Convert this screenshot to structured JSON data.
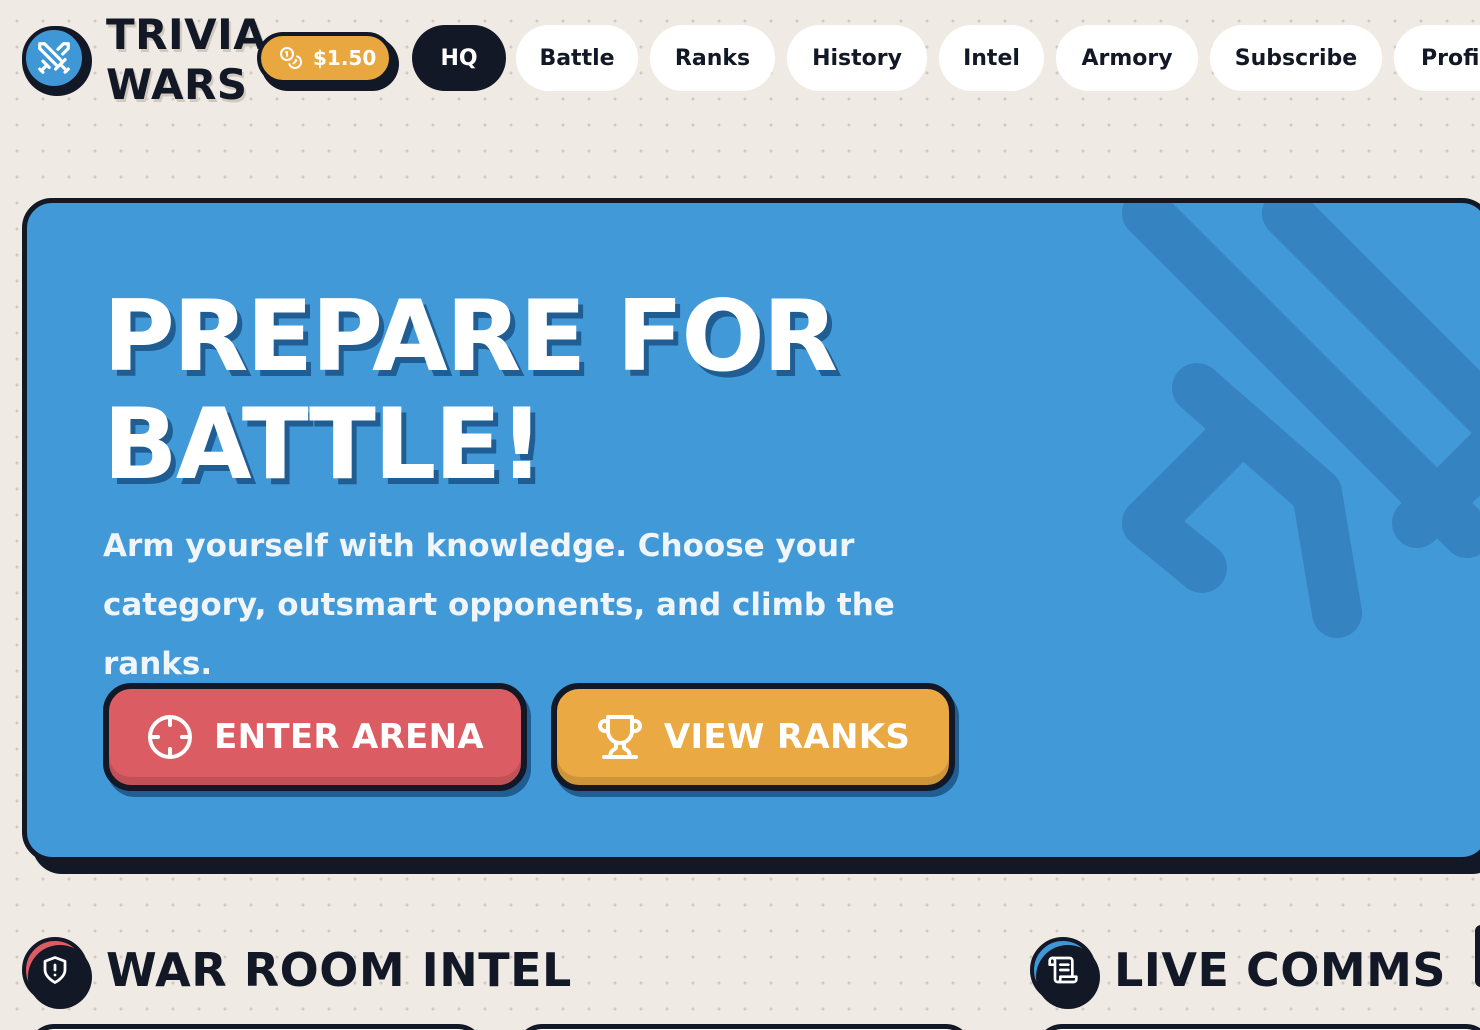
{
  "header": {
    "logo_line1": "TRIVIA",
    "logo_line2": "WARS",
    "logo_icon": "crossed-swords-icon",
    "coins_label": "$1.50",
    "coins_icon": "coins-icon",
    "nav": [
      {
        "label": "HQ",
        "active": true
      },
      {
        "label": "Battle"
      },
      {
        "label": "Ranks"
      },
      {
        "label": "History"
      },
      {
        "label": "Intel"
      },
      {
        "label": "Armory"
      },
      {
        "label": "Subscribe"
      },
      {
        "label": "Profil"
      }
    ]
  },
  "hero": {
    "title_line1": "PREPARE FOR",
    "title_line2": "BATTLE!",
    "subtitle": "Arm yourself with knowledge. Choose your category, outsmart opponents, and climb the ranks.",
    "primary_button": {
      "label": "ENTER ARENA",
      "icon": "crosshair-icon"
    },
    "secondary_button": {
      "label": "VIEW RANKS",
      "icon": "trophy-icon"
    }
  },
  "sections": {
    "war_room": {
      "title": "WAR ROOM INTEL",
      "icon": "shield-alert-icon"
    },
    "live_comms": {
      "title": "LIVE COMMS",
      "icon": "scroll-icon"
    }
  },
  "colors": {
    "ink": "#121826",
    "page_bg": "#efebe4",
    "hero_blue": "#4199d8",
    "arena_red": "#dc5c64",
    "ranks_gold": "#eaa942",
    "logo_blue": "#3f97d6"
  }
}
